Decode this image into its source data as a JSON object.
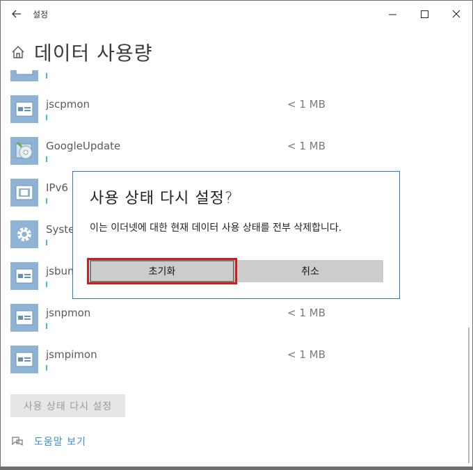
{
  "window": {
    "title": "설정",
    "back_icon": "arrow-left-icon",
    "minimize_icon": "minimize-icon",
    "maximize_icon": "maximize-icon",
    "close_icon": "close-icon"
  },
  "header": {
    "title": "데이터 사용량",
    "icon": "home-icon"
  },
  "apps": [
    {
      "name": "",
      "size": "",
      "icon": "app-window-icon"
    },
    {
      "name": "jscpmon",
      "size": "< 1 MB",
      "icon": "app-window-icon"
    },
    {
      "name": "GoogleUpdate",
      "size": "< 1 MB",
      "icon": "google-update-icon"
    },
    {
      "name": "IPv6",
      "size": "",
      "icon": "ipv6-app-icon"
    },
    {
      "name": "System",
      "size": "",
      "icon": "gear-icon"
    },
    {
      "name": "jsbum",
      "size": "",
      "icon": "app-window-icon"
    },
    {
      "name": "jsnpmon",
      "size": "< 1 MB",
      "icon": "app-window-icon"
    },
    {
      "name": "jsmpimon",
      "size": "< 1 MB",
      "icon": "app-window-icon"
    }
  ],
  "reset_button_label": "사용 상태 다시 설정",
  "help": {
    "label": "도움말 보기",
    "icon": "help-chat-icon"
  },
  "dialog": {
    "title": "사용 상태 다시 설정?",
    "message": "이는 이더넷에 대한 현재 데이터 사용 상태를 전부 삭제합니다.",
    "confirm_label": "초기화",
    "cancel_label": "취소"
  },
  "colors": {
    "accent": "#2b78c6",
    "highlight": "#d11a1a",
    "app_icon": "#8fb3d4",
    "usage_bar": "#4cb8cf",
    "link": "#3c8dd0"
  }
}
